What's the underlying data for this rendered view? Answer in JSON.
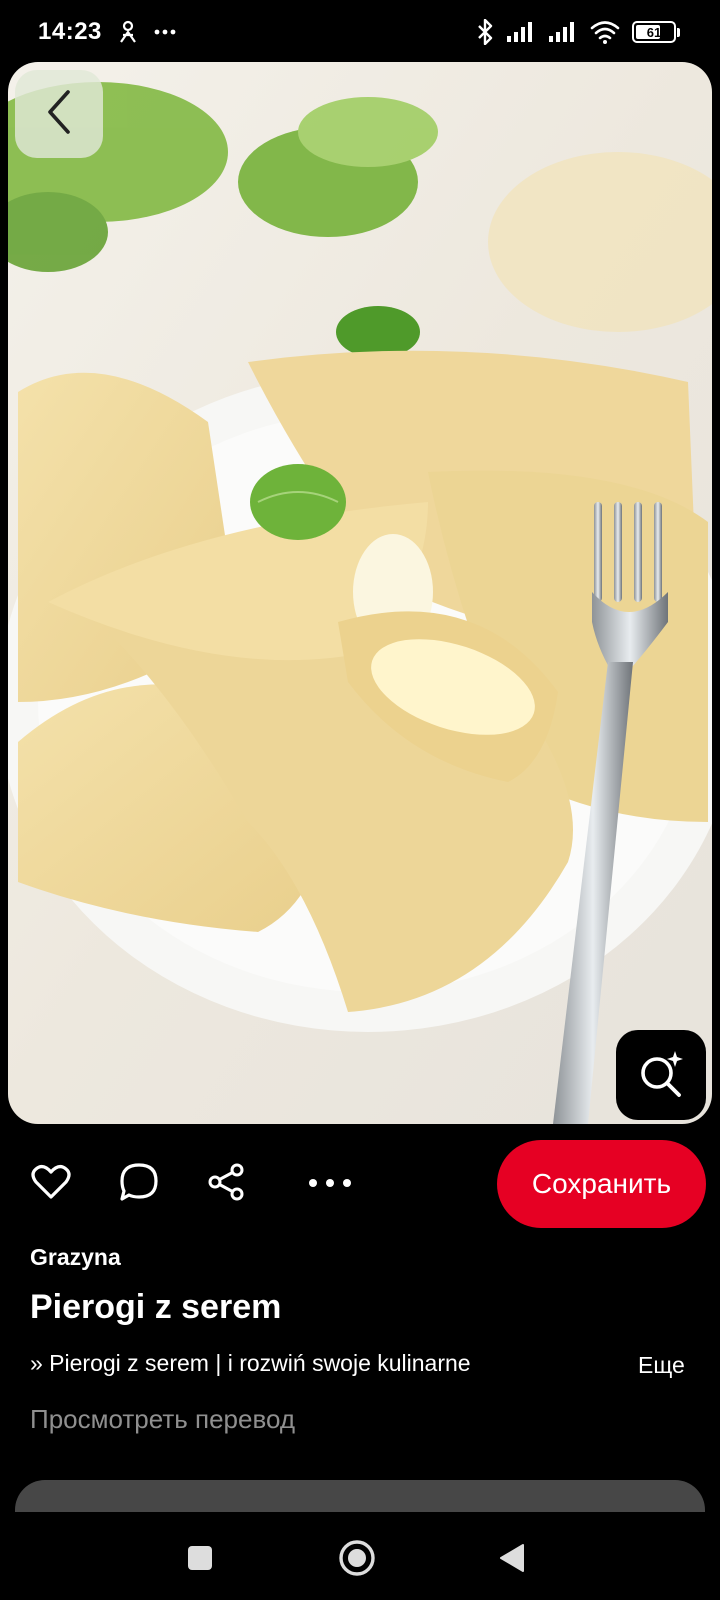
{
  "status_bar": {
    "time": "14:23",
    "battery_level": "61",
    "battery_fraction": 0.61,
    "icons": [
      "person-icon",
      "more-dots-icon",
      "bluetooth-icon",
      "signal-icon",
      "signal-icon",
      "wifi-icon",
      "battery-icon"
    ]
  },
  "pin": {
    "image_subject": "pierogi with cheese filling on a white plate with a fork and mint leaves",
    "back_icon": "chevron-left-icon",
    "lens_icon": "visual-search-icon"
  },
  "actions": {
    "icons": [
      "heart-icon",
      "comment-icon",
      "share-icon",
      "more-icon"
    ],
    "save_label": "Сохранить"
  },
  "info": {
    "author": "Grazyna",
    "title": "Pierogi z serem",
    "description": "» Pierogi z serem | i rozwiń swoje kulinarne",
    "more_label": "Еще",
    "translate_label": "Просмотреть перевод"
  },
  "nav_bar": {
    "icons": [
      "recents-square-icon",
      "home-circle-icon",
      "back-triangle-icon"
    ]
  },
  "colors": {
    "background": "#000000",
    "accent": "#e60023",
    "muted_text": "#8f8f8f",
    "card": "#474747"
  }
}
